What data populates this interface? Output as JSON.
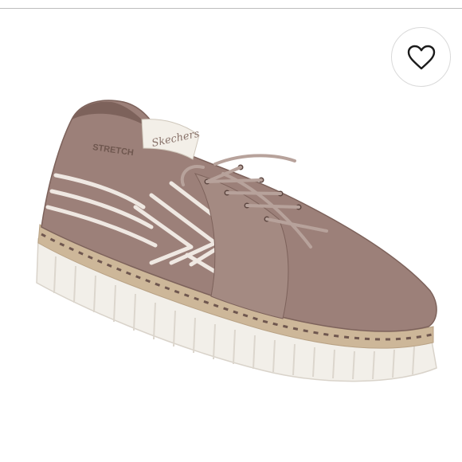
{
  "product": {
    "brand_logo_text": "Skechers",
    "insole_print": "STRETCH",
    "colors": {
      "upper": "#9c8079",
      "upper_dark": "#7d625b",
      "stripe": "#efe8e2",
      "sole": "#f2efe9",
      "sole_shadow": "#dcd6cd",
      "jute": "#cdb799",
      "stitch": "#6f574f"
    }
  },
  "favorite": {
    "icon": "heart-outline-icon"
  }
}
